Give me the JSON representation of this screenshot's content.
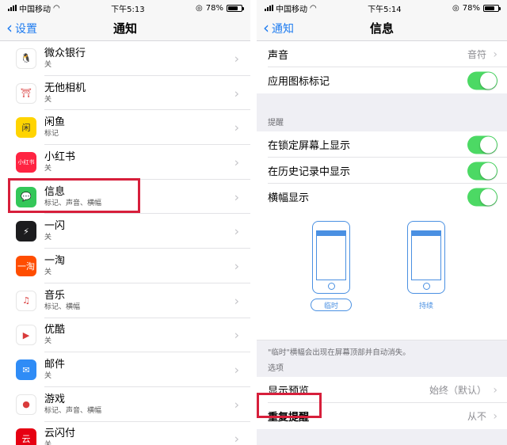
{
  "left": {
    "status": {
      "carrier": "中国移动",
      "time": "下午5:13",
      "battery": "78%",
      "battery_level": 0.78
    },
    "nav": {
      "back_label": "设置",
      "title": "通知"
    },
    "apps": [
      {
        "name": "微众银行",
        "sub": "关",
        "icon": "webank-icon",
        "color": "#ffffff",
        "glyph": "🐧"
      },
      {
        "name": "无他相机",
        "sub": "关",
        "icon": "wuta-camera-icon",
        "color": "#ffffff",
        "glyph": "⛩"
      },
      {
        "name": "闲鱼",
        "sub": "标记",
        "icon": "xianyu-icon",
        "color": "#ffd400",
        "glyph": "闲"
      },
      {
        "name": "小红书",
        "sub": "关",
        "icon": "xiaohongshu-icon",
        "color": "#ff2442",
        "glyph": "小红书"
      },
      {
        "name": "信息",
        "sub": "标记、声音、横幅",
        "icon": "messages-icon",
        "color": "#34c759",
        "glyph": "💬"
      },
      {
        "name": "一闪",
        "sub": "关",
        "icon": "yishan-icon",
        "color": "#1c1c1e",
        "glyph": "⚡"
      },
      {
        "name": "一淘",
        "sub": "关",
        "icon": "yitao-icon",
        "color": "#ff4d00",
        "glyph": "一淘"
      },
      {
        "name": "音乐",
        "sub": "标记、横幅",
        "icon": "music-icon",
        "color": "#ffffff",
        "glyph": "♫"
      },
      {
        "name": "优酷",
        "sub": "关",
        "icon": "youku-icon",
        "color": "#ffffff",
        "glyph": "▶"
      },
      {
        "name": "邮件",
        "sub": "关",
        "icon": "mail-icon",
        "color": "#2f8cf6",
        "glyph": "✉"
      },
      {
        "name": "游戏",
        "sub": "标记、声音、横幅",
        "icon": "game-center-icon",
        "color": "#ffffff",
        "glyph": "●"
      },
      {
        "name": "云闪付",
        "sub": "关",
        "icon": "unionpay-icon",
        "color": "#e60012",
        "glyph": "云"
      }
    ]
  },
  "right": {
    "status": {
      "carrier": "中国移动",
      "time": "下午5:14",
      "battery": "78%",
      "battery_level": 0.78
    },
    "nav": {
      "back_label": "通知",
      "title": "信息"
    },
    "sound": {
      "label": "声音",
      "value": "音符"
    },
    "badge": {
      "label": "应用图标标记",
      "on": true
    },
    "alerts_header": "提醒",
    "lockscreen": {
      "label": "在锁定屏幕上显示",
      "on": true
    },
    "history": {
      "label": "在历史记录中显示",
      "on": true
    },
    "banners": {
      "label": "横幅显示",
      "on": true
    },
    "banner_styles": {
      "temporary": "临时",
      "persistent": "持续",
      "selected": "临时"
    },
    "banner_note": "\"临时\"横幅会出现在屏幕顶部并自动消失。",
    "options_header": "选项",
    "preview": {
      "label": "显示预览",
      "value": "始终（默认）"
    },
    "repeat": {
      "label": "重复提醒",
      "value": "从不"
    }
  },
  "accent_color": "#1f7cf0",
  "toggle_color": "#4cd964",
  "highlight_color": "#d71f3b"
}
